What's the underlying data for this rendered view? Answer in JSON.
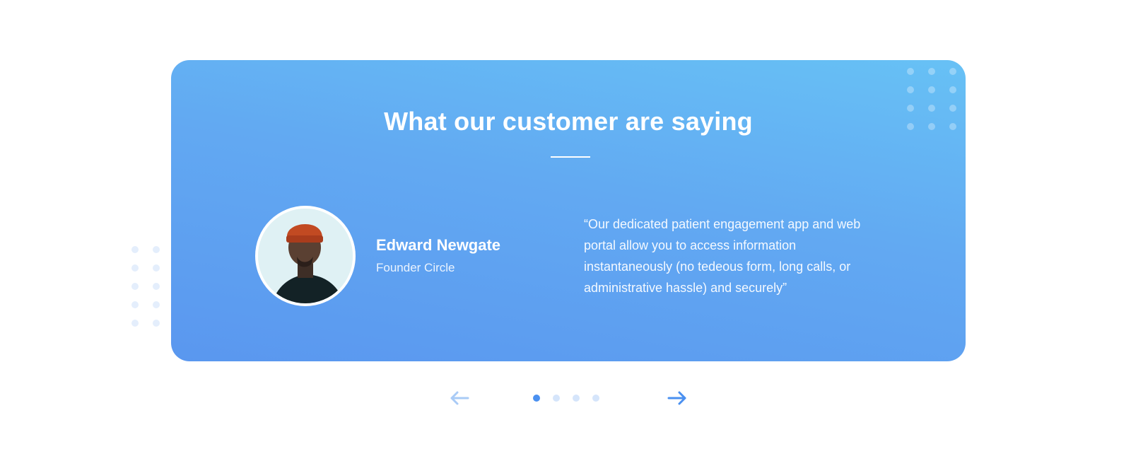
{
  "testimonials": {
    "title": "What our customer are saying",
    "current": {
      "name": "Edward Newgate",
      "role": "Founder Circle",
      "quote": "“Our dedicated patient engagement app and web portal allow you to access information instantaneously (no tedeous form, long calls, or administrative hassle) and securely”"
    },
    "colors": {
      "card_gradient_start": "#67c1f5",
      "card_gradient_end": "#5a97ef",
      "pager_active": "#4a90f0",
      "pager_inactive": "#d5e5fb",
      "arrow_prev": "#a9cbf6",
      "arrow_next": "#4a90f0"
    }
  },
  "navigation": {
    "prev_icon": "arrow-left-icon",
    "next_icon": "arrow-right-icon",
    "page_count": 4,
    "active_page": 1
  }
}
